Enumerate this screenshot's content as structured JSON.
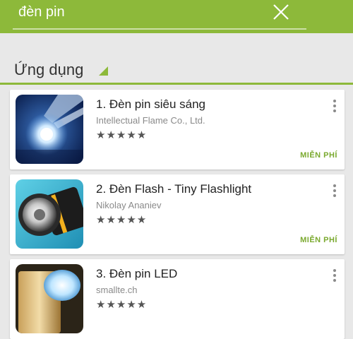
{
  "search": {
    "query": "đèn pin"
  },
  "section": {
    "title": "Ứng dụng"
  },
  "apps": [
    {
      "title": "1. Đèn pin siêu sáng",
      "developer": "Intellectual Flame Co., Ltd.",
      "rating": "★★★★★",
      "rating_value": 4.5,
      "price": "MIỄN PHÍ",
      "icon": "flashlight-beam-icon"
    },
    {
      "title": "2. Đèn Flash - Tiny Flashlight",
      "developer": "Nikolay Ananiev",
      "rating": "★★★★★",
      "rating_value": 4.5,
      "price": "MIỄN PHÍ",
      "icon": "torch-lens-icon"
    },
    {
      "title": "3. Đèn pin LED",
      "developer": "smallte.ch",
      "rating": "★★★★★",
      "rating_value": 4.5,
      "price": "",
      "icon": "led-torch-icon"
    }
  ],
  "colors": {
    "accent": "#8db93a",
    "price": "#7aa92e",
    "background": "#e8e8e8"
  }
}
